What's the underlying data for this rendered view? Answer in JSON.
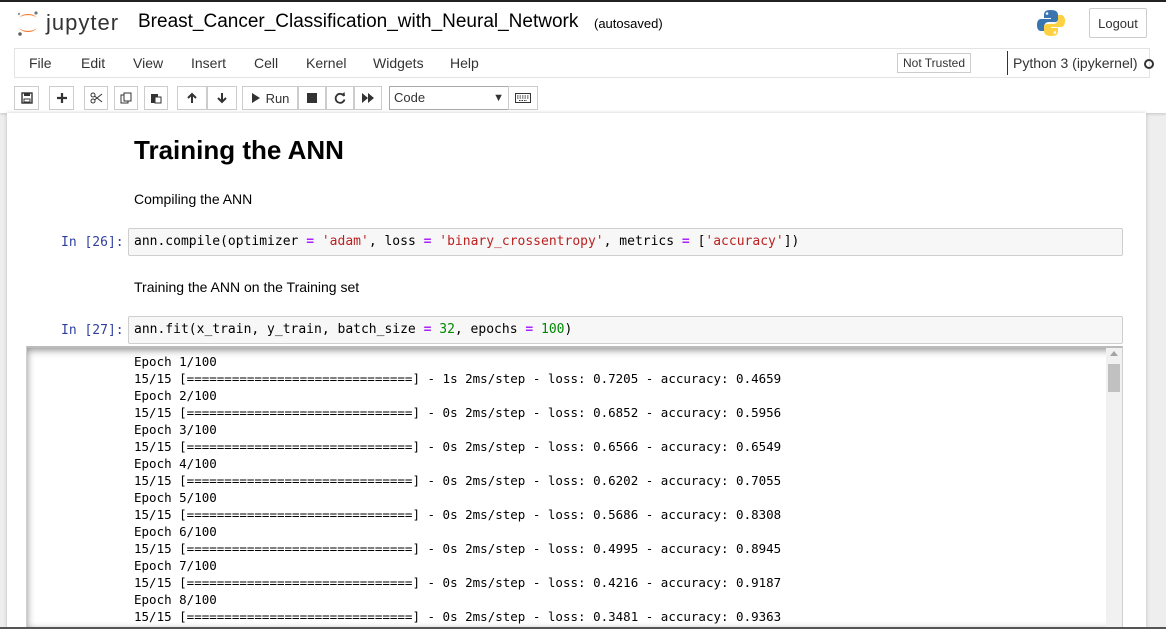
{
  "header": {
    "logo_text": "jupyter",
    "notebook_title": "Breast_Cancer_Classification_with_Neural_Network",
    "autosave_status": "(autosaved)",
    "logout_label": "Logout"
  },
  "menu": {
    "items": [
      "File",
      "Edit",
      "View",
      "Insert",
      "Cell",
      "Kernel",
      "Widgets",
      "Help"
    ],
    "trust_status": "Not Trusted",
    "kernel_name": "Python 3 (ipykernel)"
  },
  "toolbar": {
    "run_label": "Run",
    "cell_type": "Code",
    "icons": [
      "save-icon",
      "plus-icon",
      "scissors-icon",
      "copy-icon",
      "paste-icon",
      "arrow-up-icon",
      "arrow-down-icon",
      "run-icon",
      "stop-icon",
      "restart-icon",
      "fast-forward-icon",
      "keyboard-icon"
    ]
  },
  "notebook": {
    "heading": "Training the ANN",
    "md1": "Compiling the ANN",
    "cell26": {
      "prompt": "In [26]:",
      "code": "ann.compile(optimizer = 'adam', loss = 'binary_crossentropy', metrics = ['accuracy'])"
    },
    "md2": "Training the ANN on the Training set",
    "cell27": {
      "prompt": "In [27]:",
      "code": "ann.fit(x_train, y_train, batch_size = 32, epochs = 100)"
    },
    "output_lines": [
      "Epoch 1/100",
      "15/15 [==============================] - 1s 2ms/step - loss: 0.7205 - accuracy: 0.4659",
      "Epoch 2/100",
      "15/15 [==============================] - 0s 2ms/step - loss: 0.6852 - accuracy: 0.5956",
      "Epoch 3/100",
      "15/15 [==============================] - 0s 2ms/step - loss: 0.6566 - accuracy: 0.6549",
      "Epoch 4/100",
      "15/15 [==============================] - 0s 2ms/step - loss: 0.6202 - accuracy: 0.7055",
      "Epoch 5/100",
      "15/15 [==============================] - 0s 2ms/step - loss: 0.5686 - accuracy: 0.8308",
      "Epoch 6/100",
      "15/15 [==============================] - 0s 2ms/step - loss: 0.4995 - accuracy: 0.8945",
      "Epoch 7/100",
      "15/15 [==============================] - 0s 2ms/step - loss: 0.4216 - accuracy: 0.9187",
      "Epoch 8/100",
      "15/15 [==============================] - 0s 2ms/step - loss: 0.3481 - accuracy: 0.9363"
    ]
  },
  "colors": {
    "prompt": "#303f9f",
    "logo_orange": "#f37726",
    "string": "#ba2121",
    "number": "#008000",
    "operator": "#aa22ff"
  }
}
